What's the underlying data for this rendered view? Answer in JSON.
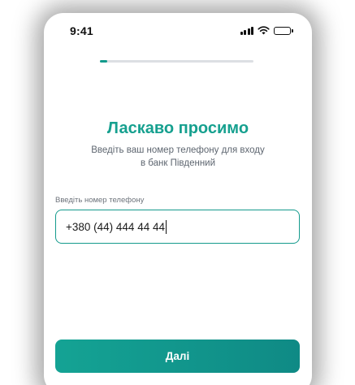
{
  "status_bar": {
    "time": "9:41"
  },
  "progress": {
    "value": 0.05,
    "color": "#139a8c"
  },
  "welcome": {
    "title": "Ласкаво просимо",
    "subtitle_line1": "Введіть ваш номер телефону для входу",
    "subtitle_line2": "в банк Південний"
  },
  "phone_field": {
    "label": "Введіть номер телефону",
    "value": "+380 (44) 444 44 44"
  },
  "next_button": {
    "label": "Далі"
  },
  "colors": {
    "accent": "#16a08f",
    "button_gradient_start": "#14a394",
    "button_gradient_end": "#0f8a85"
  },
  "icons": [
    "signal-icon",
    "wifi-icon",
    "battery-icon"
  ]
}
